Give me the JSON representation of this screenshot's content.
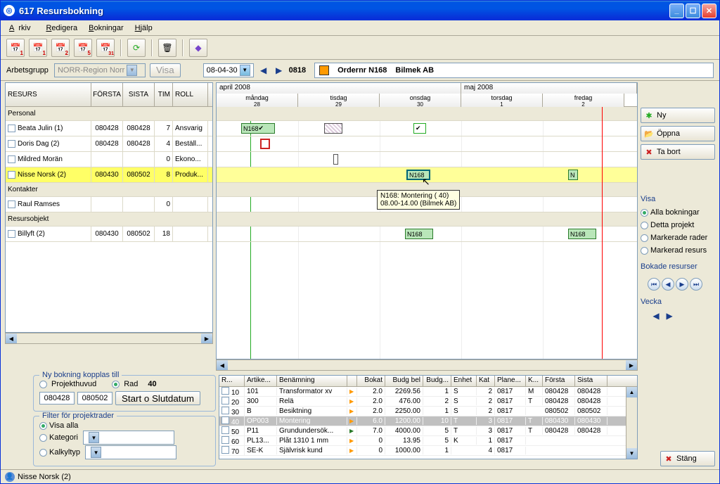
{
  "window": {
    "title": "617 Resursbokning"
  },
  "menu": {
    "arkiv": "Arkiv",
    "redigera": "Redigera",
    "bokningar": "Bokningar",
    "hjalp": "Hjälp"
  },
  "filterbar": {
    "arbetsgrupp_label": "Arbetsgrupp",
    "arbetsgrupp_value": "NORR-Region Norr",
    "visa_btn": "Visa",
    "date": "08-04-30",
    "time": "0818",
    "order_label": "Ordernr N168",
    "customer": "Bilmek AB"
  },
  "grid": {
    "headers": {
      "resurs": "RESURS",
      "forsta": "FÖRSTA",
      "sista": "SISTA",
      "tim": "TIM",
      "roll": "ROLL"
    },
    "sections": {
      "personal": "Personal",
      "kontakter": "Kontakter",
      "resursobjekt": "Resursobjekt"
    },
    "rows": {
      "beata": {
        "name": "Beata Julin (1)",
        "forsta": "080428",
        "sista": "080428",
        "tim": "7",
        "roll": "Ansvarig"
      },
      "doris": {
        "name": "Doris Dag (2)",
        "forsta": "080428",
        "sista": "080428",
        "tim": "4",
        "roll": "Beställ..."
      },
      "mildred": {
        "name": "Mildred Morän",
        "forsta": "",
        "sista": "",
        "tim": "0",
        "roll": "Ekono..."
      },
      "nisse": {
        "name": "Nisse Norsk (2)",
        "forsta": "080430",
        "sista": "080502",
        "tim": "8",
        "roll": "Produk..."
      },
      "raul": {
        "name": "Raul Ramses",
        "forsta": "",
        "sista": "",
        "tim": "0",
        "roll": ""
      },
      "billyft": {
        "name": "Billyft (2)",
        "forsta": "080430",
        "sista": "080502",
        "tim": "18",
        "roll": ""
      }
    }
  },
  "gantt": {
    "months": {
      "april": "april 2008",
      "maj": "maj 2008"
    },
    "days": {
      "mon": "måndag",
      "tue": "tisdag",
      "wed": "onsdag",
      "thu": "torsdag",
      "fri": "fredag",
      "d28": "28",
      "d29": "29",
      "d30": "30",
      "d1": "1",
      "d2": "2"
    },
    "bars": {
      "n168": "N168",
      "n": "N"
    },
    "tooltip": {
      "line1": "N168: Montering (   40)",
      "line2": "08.00-14.00 (Bilmek AB)"
    }
  },
  "side": {
    "ny": "Ny",
    "oppna": "Öppna",
    "tabort": "Ta bort",
    "visa": "Visa",
    "alla": "Alla bokningar",
    "detta": "Detta projekt",
    "markerade": "Markerade rader",
    "markerad_resurs": "Markerad resurs",
    "bokade": "Bokade resurser",
    "vecka": "Vecka"
  },
  "bottom": {
    "nybokning": {
      "legend": "Ny bokning kopplas till",
      "projekthuvud": "Projekthuvud",
      "rad": "Rad",
      "radnum": "40",
      "date1": "080428",
      "date2": "080502",
      "slut_btn": "Start o Slutdatum"
    },
    "filter": {
      "legend": "Filter för projektrader",
      "visa_alla": "Visa alla",
      "kategori": "Kategori",
      "kalkyltyp": "Kalkyltyp"
    }
  },
  "projgrid": {
    "headers": {
      "r": "R...",
      "artike": "Artike...",
      "benamning": "Benämning",
      "bokat": "Bokat",
      "budgbel": "Budg bel",
      "budg": "Budg...",
      "enhet": "Enhet",
      "kat": "Kat",
      "plane": "Plane...",
      "k": "K...",
      "forsta": "Första",
      "sista": "Sista"
    },
    "rows": [
      {
        "r": "10",
        "art": "101",
        "ben": "Transformator xv",
        "bokat": "2.0",
        "budgbel": "2269.56",
        "budg": "1",
        "enhet": "S",
        "kat": "2",
        "plane": "0817",
        "k": "M",
        "forsta": "080428",
        "sista": "080428"
      },
      {
        "r": "20",
        "art": "300",
        "ben": "Relä",
        "bokat": "2.0",
        "budgbel": "476.00",
        "budg": "2",
        "enhet": "S",
        "kat": "2",
        "plane": "0817",
        "k": "T",
        "forsta": "080428",
        "sista": "080428"
      },
      {
        "r": "30",
        "art": "B",
        "ben": "Besiktning",
        "bokat": "2.0",
        "budgbel": "2250.00",
        "budg": "1",
        "enhet": "S",
        "kat": "2",
        "plane": "0817",
        "k": "",
        "forsta": "080502",
        "sista": "080502"
      },
      {
        "r": "40",
        "art": "OP003",
        "ben": "Montering",
        "bokat": "6.0",
        "budgbel": "1200.00",
        "budg": "10",
        "enhet": "T",
        "kat": "3",
        "plane": "0817",
        "k": "T",
        "forsta": "080430",
        "sista": "080430",
        "sel": true
      },
      {
        "r": "50",
        "art": "P11",
        "ben": "Grundundersök...",
        "bokat": "7.0",
        "budgbel": "4000.00",
        "budg": "5",
        "enhet": "T",
        "kat": "3",
        "plane": "0817",
        "k": "T",
        "forsta": "080428",
        "sista": "080428",
        "tri": "g"
      },
      {
        "r": "60",
        "art": "PL13...",
        "ben": "Plåt 1310 1 mm",
        "bokat": "0",
        "budgbel": "13.95",
        "budg": "5",
        "enhet": "K",
        "kat": "1",
        "plane": "0817",
        "k": "",
        "forsta": "",
        "sista": ""
      },
      {
        "r": "70",
        "art": "SE-K",
        "ben": "Självrisk kund",
        "bokat": "0",
        "budgbel": "1000.00",
        "budg": "1",
        "enhet": "",
        "kat": "4",
        "plane": "0817",
        "k": "",
        "forsta": "",
        "sista": ""
      }
    ]
  },
  "stangbtn": "Stäng",
  "statusbar": {
    "user": "Nisse Norsk (2)"
  },
  "colors": {
    "accent": "#0054e3",
    "highlight": "#ffff66",
    "order": "#ff9a00"
  }
}
